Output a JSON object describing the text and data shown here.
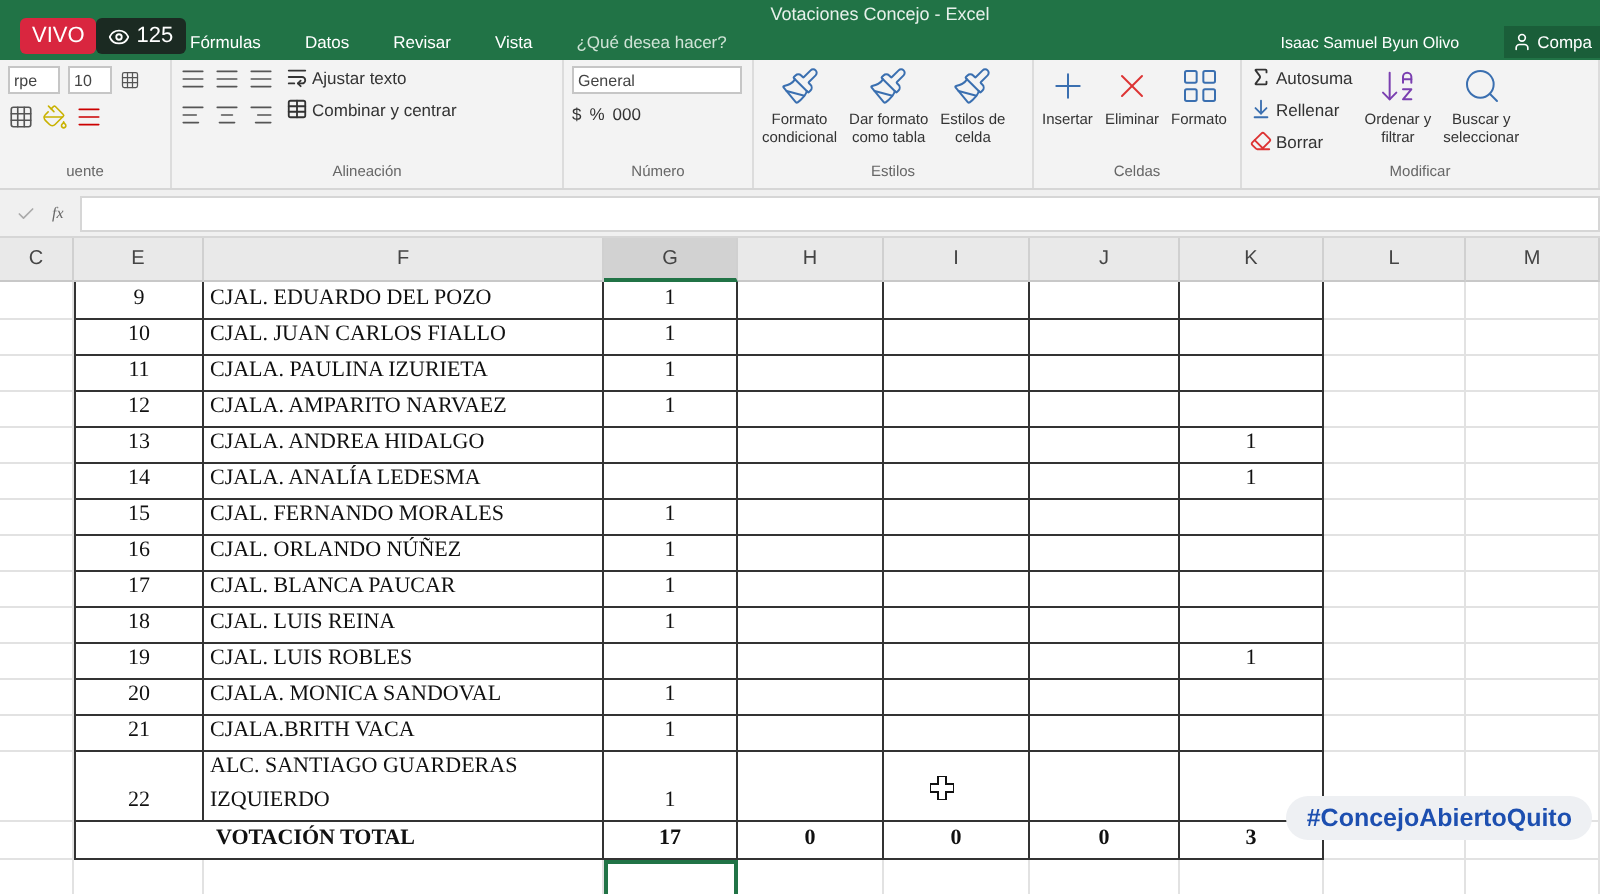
{
  "window": {
    "title": "Votaciones Concejo - Excel"
  },
  "tabs": [
    {
      "label": "Fórmulas",
      "selected": false
    },
    {
      "label": "Datos",
      "selected": false
    },
    {
      "label": "Revisar",
      "selected": false
    },
    {
      "label": "Vista",
      "selected": false
    }
  ],
  "tell_me": {
    "placeholder": "¿Qué desea hacer?"
  },
  "user": "Isaac Samuel Byun Olivo",
  "share": "Compa",
  "ribbon": {
    "font": {
      "font_name": "rpe",
      "font_size": "10",
      "group": "uente"
    },
    "alignment": {
      "wrap": "Ajustar texto",
      "merge": "Combinar y centrar",
      "group": "Alineación"
    },
    "number": {
      "format": "General",
      "currency": "$",
      "percent": "%",
      "thousands": "000",
      "group": "Número"
    },
    "styles": {
      "buttons": [
        "Formato\ncondicional",
        "Dar formato\ncomo tabla",
        "Estilos de\ncelda"
      ],
      "group": "Estilos"
    },
    "cells": {
      "buttons": [
        "Insertar",
        "Eliminar",
        "Formato"
      ],
      "group": "Celdas"
    },
    "editing": {
      "autosum": "Autosuma",
      "fill": "Rellenar",
      "clear": "Borrar",
      "sort": "Ordenar y\nfiltrar",
      "find": "Buscar y\nseleccionar",
      "group": "Modificar"
    }
  },
  "formula_bar": {
    "fx": "fx"
  },
  "columns": [
    {
      "label": "C",
      "selected": false
    },
    {
      "label": "E",
      "selected": false
    },
    {
      "label": "F",
      "selected": false
    },
    {
      "label": "G",
      "selected": true
    },
    {
      "label": "H",
      "selected": false
    },
    {
      "label": "I",
      "selected": false
    },
    {
      "label": "J",
      "selected": false
    },
    {
      "label": "K",
      "selected": false
    },
    {
      "label": "L",
      "selected": false
    },
    {
      "label": "M",
      "selected": false
    }
  ],
  "rows": [
    {
      "number": "9",
      "name": "CJAL. EDUARDO DEL POZO",
      "g": "1",
      "k": ""
    },
    {
      "number": "10",
      "name": "CJAL. JUAN CARLOS FIALLO",
      "g": "1",
      "k": ""
    },
    {
      "number": "11",
      "name": "CJALA. PAULINA IZURIETA",
      "g": "1",
      "k": ""
    },
    {
      "number": "12",
      "name": "CJALA. AMPARITO NARVAEZ",
      "g": "1",
      "k": ""
    },
    {
      "number": "13",
      "name": "CJALA. ANDREA HIDALGO",
      "g": "",
      "k": "1"
    },
    {
      "number": "14",
      "name": "CJALA. ANALÍA LEDESMA",
      "g": "",
      "k": "1"
    },
    {
      "number": "15",
      "name": "CJAL. FERNANDO MORALES",
      "g": "1",
      "k": ""
    },
    {
      "number": "16",
      "name": "CJAL. ORLANDO NÚÑEZ",
      "g": "1",
      "k": ""
    },
    {
      "number": "17",
      "name": "CJAL. BLANCA PAUCAR",
      "g": "1",
      "k": ""
    },
    {
      "number": "18",
      "name": "CJAL. LUIS REINA",
      "g": "1",
      "k": ""
    },
    {
      "number": "19",
      "name": "CJAL. LUIS ROBLES",
      "g": "",
      "k": "1"
    },
    {
      "number": "20",
      "name": "CJALA. MONICA SANDOVAL",
      "g": "1",
      "k": ""
    },
    {
      "number": "21",
      "name": "CJALA.BRITH VACA",
      "g": "1",
      "k": ""
    },
    {
      "number": "22",
      "name": "ALC. SANTIAGO GUARDERAS IZQUIERDO",
      "g": "1",
      "k": ""
    }
  ],
  "total": {
    "label": "VOTACIÓN TOTAL",
    "g": "17",
    "h": "0",
    "i": "0",
    "j": "0",
    "k": "3"
  },
  "live": {
    "badge": "VIVO",
    "viewers": "125"
  },
  "hashtag": "#ConcejoAbiertoQuito"
}
